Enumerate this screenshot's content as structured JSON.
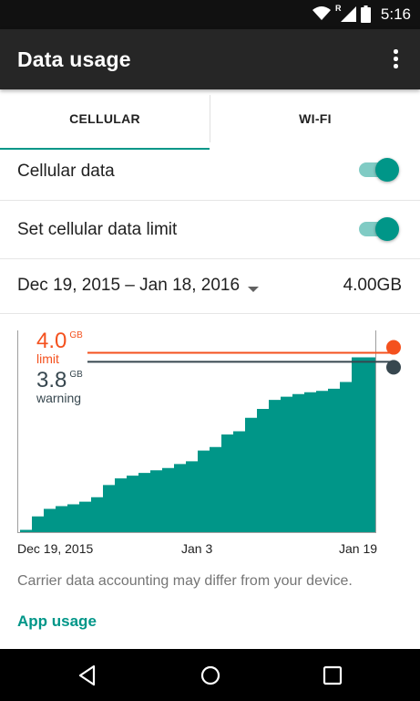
{
  "status_bar": {
    "time": "5:16",
    "icons": [
      "wifi-icon",
      "roaming-icon",
      "signal-icon",
      "battery-icon"
    ],
    "roaming_text": "R"
  },
  "app_bar": {
    "title": "Data usage",
    "overflow_icon": "more-vert-icon"
  },
  "tabs": [
    {
      "label": "CELLULAR",
      "selected": true
    },
    {
      "label": "WI-FI",
      "selected": false
    }
  ],
  "settings": {
    "cellular_data": {
      "label": "Cellular data",
      "enabled": true
    },
    "data_limit": {
      "label": "Set cellular data limit",
      "enabled": true
    }
  },
  "cycle": {
    "range": "Dec 19, 2015 – Jan 18, 2016",
    "total": "4.00GB",
    "dropdown_icon": "arrow-drop-down-icon"
  },
  "colors": {
    "accent": "#009688",
    "accent_light": "#80cbc4",
    "limit": "#f4511e",
    "warning": "#37474f",
    "app_bar": "#262626"
  },
  "chart_data": {
    "type": "area",
    "x_ticks": [
      "Dec 19, 2015",
      "Jan 3",
      "Jan 19"
    ],
    "limit": {
      "value": "4.0",
      "unit": "GB",
      "label": "limit"
    },
    "warning": {
      "value": "3.8",
      "unit": "GB",
      "label": "warning"
    },
    "usage_gb_by_day": [
      {
        "day": 0,
        "gb": 0.05
      },
      {
        "day": 1,
        "gb": 0.35
      },
      {
        "day": 2,
        "gb": 0.52
      },
      {
        "day": 3,
        "gb": 0.58
      },
      {
        "day": 4,
        "gb": 0.62
      },
      {
        "day": 5,
        "gb": 0.68
      },
      {
        "day": 6,
        "gb": 0.78
      },
      {
        "day": 7,
        "gb": 1.05
      },
      {
        "day": 8,
        "gb": 1.2
      },
      {
        "day": 9,
        "gb": 1.26
      },
      {
        "day": 10,
        "gb": 1.32
      },
      {
        "day": 11,
        "gb": 1.38
      },
      {
        "day": 12,
        "gb": 1.43
      },
      {
        "day": 13,
        "gb": 1.52
      },
      {
        "day": 14,
        "gb": 1.58
      },
      {
        "day": 15,
        "gb": 1.82
      },
      {
        "day": 16,
        "gb": 1.9
      },
      {
        "day": 17,
        "gb": 2.18
      },
      {
        "day": 18,
        "gb": 2.25
      },
      {
        "day": 19,
        "gb": 2.55
      },
      {
        "day": 20,
        "gb": 2.75
      },
      {
        "day": 21,
        "gb": 2.95
      },
      {
        "day": 22,
        "gb": 3.02
      },
      {
        "day": 23,
        "gb": 3.08
      },
      {
        "day": 24,
        "gb": 3.12
      },
      {
        "day": 25,
        "gb": 3.15
      },
      {
        "day": 26,
        "gb": 3.2
      },
      {
        "day": 27,
        "gb": 3.35
      },
      {
        "day": 28,
        "gb": 3.9
      },
      {
        "day": 29,
        "gb": 3.9
      },
      {
        "day": 30,
        "gb": 3.9
      }
    ],
    "ylim": [
      0,
      4.5
    ],
    "xlim": [
      0,
      30
    ]
  },
  "footer": {
    "disclaimer": "Carrier data accounting may differ from your device.",
    "app_usage_link": "App usage"
  },
  "nav_bar": {
    "icons": [
      "back-icon",
      "home-icon",
      "recents-icon"
    ]
  }
}
